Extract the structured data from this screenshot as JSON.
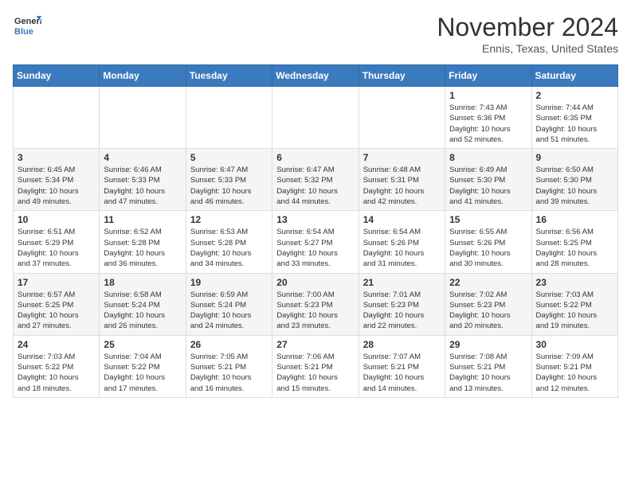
{
  "logo": {
    "general": "General",
    "blue": "Blue"
  },
  "title": "November 2024",
  "location": "Ennis, Texas, United States",
  "weekdays": [
    "Sunday",
    "Monday",
    "Tuesday",
    "Wednesday",
    "Thursday",
    "Friday",
    "Saturday"
  ],
  "weeks": [
    [
      {
        "day": "",
        "info": ""
      },
      {
        "day": "",
        "info": ""
      },
      {
        "day": "",
        "info": ""
      },
      {
        "day": "",
        "info": ""
      },
      {
        "day": "",
        "info": ""
      },
      {
        "day": "1",
        "info": "Sunrise: 7:43 AM\nSunset: 6:36 PM\nDaylight: 10 hours\nand 52 minutes."
      },
      {
        "day": "2",
        "info": "Sunrise: 7:44 AM\nSunset: 6:35 PM\nDaylight: 10 hours\nand 51 minutes."
      }
    ],
    [
      {
        "day": "3",
        "info": "Sunrise: 6:45 AM\nSunset: 5:34 PM\nDaylight: 10 hours\nand 49 minutes."
      },
      {
        "day": "4",
        "info": "Sunrise: 6:46 AM\nSunset: 5:33 PM\nDaylight: 10 hours\nand 47 minutes."
      },
      {
        "day": "5",
        "info": "Sunrise: 6:47 AM\nSunset: 5:33 PM\nDaylight: 10 hours\nand 46 minutes."
      },
      {
        "day": "6",
        "info": "Sunrise: 6:47 AM\nSunset: 5:32 PM\nDaylight: 10 hours\nand 44 minutes."
      },
      {
        "day": "7",
        "info": "Sunrise: 6:48 AM\nSunset: 5:31 PM\nDaylight: 10 hours\nand 42 minutes."
      },
      {
        "day": "8",
        "info": "Sunrise: 6:49 AM\nSunset: 5:30 PM\nDaylight: 10 hours\nand 41 minutes."
      },
      {
        "day": "9",
        "info": "Sunrise: 6:50 AM\nSunset: 5:30 PM\nDaylight: 10 hours\nand 39 minutes."
      }
    ],
    [
      {
        "day": "10",
        "info": "Sunrise: 6:51 AM\nSunset: 5:29 PM\nDaylight: 10 hours\nand 37 minutes."
      },
      {
        "day": "11",
        "info": "Sunrise: 6:52 AM\nSunset: 5:28 PM\nDaylight: 10 hours\nand 36 minutes."
      },
      {
        "day": "12",
        "info": "Sunrise: 6:53 AM\nSunset: 5:28 PM\nDaylight: 10 hours\nand 34 minutes."
      },
      {
        "day": "13",
        "info": "Sunrise: 6:54 AM\nSunset: 5:27 PM\nDaylight: 10 hours\nand 33 minutes."
      },
      {
        "day": "14",
        "info": "Sunrise: 6:54 AM\nSunset: 5:26 PM\nDaylight: 10 hours\nand 31 minutes."
      },
      {
        "day": "15",
        "info": "Sunrise: 6:55 AM\nSunset: 5:26 PM\nDaylight: 10 hours\nand 30 minutes."
      },
      {
        "day": "16",
        "info": "Sunrise: 6:56 AM\nSunset: 5:25 PM\nDaylight: 10 hours\nand 28 minutes."
      }
    ],
    [
      {
        "day": "17",
        "info": "Sunrise: 6:57 AM\nSunset: 5:25 PM\nDaylight: 10 hours\nand 27 minutes."
      },
      {
        "day": "18",
        "info": "Sunrise: 6:58 AM\nSunset: 5:24 PM\nDaylight: 10 hours\nand 26 minutes."
      },
      {
        "day": "19",
        "info": "Sunrise: 6:59 AM\nSunset: 5:24 PM\nDaylight: 10 hours\nand 24 minutes."
      },
      {
        "day": "20",
        "info": "Sunrise: 7:00 AM\nSunset: 5:23 PM\nDaylight: 10 hours\nand 23 minutes."
      },
      {
        "day": "21",
        "info": "Sunrise: 7:01 AM\nSunset: 5:23 PM\nDaylight: 10 hours\nand 22 minutes."
      },
      {
        "day": "22",
        "info": "Sunrise: 7:02 AM\nSunset: 5:23 PM\nDaylight: 10 hours\nand 20 minutes."
      },
      {
        "day": "23",
        "info": "Sunrise: 7:03 AM\nSunset: 5:22 PM\nDaylight: 10 hours\nand 19 minutes."
      }
    ],
    [
      {
        "day": "24",
        "info": "Sunrise: 7:03 AM\nSunset: 5:22 PM\nDaylight: 10 hours\nand 18 minutes."
      },
      {
        "day": "25",
        "info": "Sunrise: 7:04 AM\nSunset: 5:22 PM\nDaylight: 10 hours\nand 17 minutes."
      },
      {
        "day": "26",
        "info": "Sunrise: 7:05 AM\nSunset: 5:21 PM\nDaylight: 10 hours\nand 16 minutes."
      },
      {
        "day": "27",
        "info": "Sunrise: 7:06 AM\nSunset: 5:21 PM\nDaylight: 10 hours\nand 15 minutes."
      },
      {
        "day": "28",
        "info": "Sunrise: 7:07 AM\nSunset: 5:21 PM\nDaylight: 10 hours\nand 14 minutes."
      },
      {
        "day": "29",
        "info": "Sunrise: 7:08 AM\nSunset: 5:21 PM\nDaylight: 10 hours\nand 13 minutes."
      },
      {
        "day": "30",
        "info": "Sunrise: 7:09 AM\nSunset: 5:21 PM\nDaylight: 10 hours\nand 12 minutes."
      }
    ]
  ]
}
